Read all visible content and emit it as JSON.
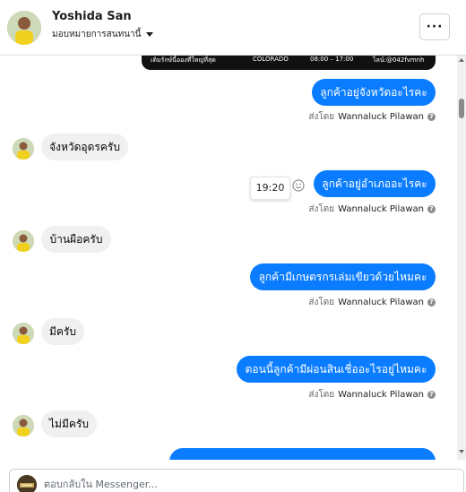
{
  "header": {
    "contact_name": "Yoshida San",
    "assign_label": "มอบหมายการสนทนานี้",
    "more_label": "···"
  },
  "banner": {
    "left_text": "เติมรักษ์นี้อองที่ใหญ่ที่สุด",
    "mid_text": "COLORADO",
    "hours_text": "08:00 – 17:00",
    "line_text": "ไลน์:@042fvmnh"
  },
  "messages": [
    {
      "direction": "out",
      "text": "ลูกค้าอยู่จังหวัดอะไรคะ"
    },
    {
      "direction": "in",
      "text": "จังหวัดอุดรครับ"
    },
    {
      "direction": "out",
      "text": "ลูกค้าอยู่อำเภออะไรคะ"
    },
    {
      "direction": "in",
      "text": "บ้านผือครับ"
    },
    {
      "direction": "out",
      "text": "ลูกค้ามีเกษตรกรเล่มเขียวด้วยไหมคะ"
    },
    {
      "direction": "in",
      "text": "มีครับ"
    },
    {
      "direction": "out",
      "text": "ตอนนี้ลูกค้ามีผ่อนสินเชื่ออะไรอยู่ไหมคะ"
    },
    {
      "direction": "in",
      "text": "ไม่มีครับ"
    }
  ],
  "sent_by": {
    "prefix": "ส่งโดย",
    "name": "Wannaluck Pilawan",
    "info": "?"
  },
  "timestamp": "19:20",
  "composer": {
    "placeholder": "ตอบกลับใน Messenger..."
  },
  "colors": {
    "outgoing_bubble": "#0a7cff",
    "incoming_bubble": "#f0f0f0"
  },
  "icons": [
    "chevron-down-icon",
    "reply-icon",
    "emoji-icon",
    "info-icon"
  ]
}
